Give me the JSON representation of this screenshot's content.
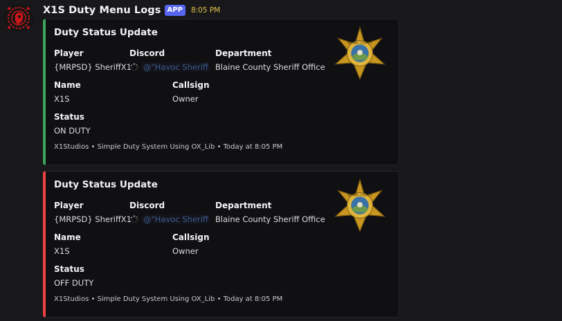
{
  "app": {
    "username": "X1S Duty Menu Logs",
    "badge": "APP",
    "time": "8:05 PM"
  },
  "colors": {
    "on_duty_accent": "#3ba55c",
    "off_duty_accent": "#ed4245",
    "app_badge": "#5865f2",
    "timestamp": "#e3c44a"
  },
  "embeds": [
    {
      "title": "Duty Status Update",
      "fields": {
        "player_label": "Player",
        "player_value": "{MRPSD} SheriffX1",
        "discord_label": "Discord",
        "discord_value": "@\"Havoc Sheriff",
        "department_label": "Department",
        "department_value": "Blaine County Sheriff Office",
        "name_label": "Name",
        "name_value": "X1S",
        "callsign_label": "Callsign",
        "callsign_value": "Owner",
        "status_label": "Status",
        "status_value": "ON DUTY"
      },
      "footer": "X1Studios • Simple Duty System Using OX_Lib • Today at 8:05 PM",
      "thumbnail": "sheriff-star-badge-icon",
      "thumbnail_text": "BLAINE COUNTY"
    },
    {
      "title": "Duty Status Update",
      "fields": {
        "player_label": "Player",
        "player_value": "{MRPSD} SheriffX1",
        "discord_label": "Discord",
        "discord_value": "@\"Havoc Sheriff",
        "department_label": "Department",
        "department_value": "Blaine County Sheriff Office",
        "name_label": "Name",
        "name_value": "X1S",
        "callsign_label": "Callsign",
        "callsign_value": "Owner",
        "status_label": "Status",
        "status_value": "OFF DUTY"
      },
      "footer": "X1Studios • Simple Duty System Using OX_Lib • Today at 8:05 PM",
      "thumbnail": "sheriff-star-badge-icon",
      "thumbnail_text": "BLAINE COUNTY"
    }
  ]
}
